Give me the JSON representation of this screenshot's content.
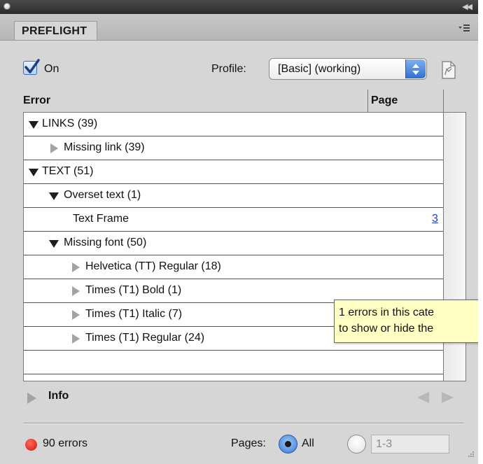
{
  "window": {
    "collapse_icon": "double-chevron-right-icon"
  },
  "panel": {
    "tab_label": "PREFLIGHT",
    "menu_icon": "panel-menu-icon"
  },
  "controls": {
    "on_label": "On",
    "on_checked": true,
    "profile_label": "Profile:",
    "profile_value": "[Basic] (working)"
  },
  "table": {
    "columns": [
      "Error",
      "Page"
    ],
    "rows": [
      {
        "label": "LINKS (39)",
        "level": 0,
        "expander": "expanded",
        "page": ""
      },
      {
        "label": "Missing link (39)",
        "level": 1,
        "expander": "collapsed",
        "page": ""
      },
      {
        "label": "TEXT (51)",
        "level": 0,
        "expander": "expanded",
        "page": ""
      },
      {
        "label": "Overset text (1)",
        "level": 1,
        "expander": "expanded",
        "page": ""
      },
      {
        "label": "Text Frame",
        "level": 2,
        "expander": "none",
        "page": "3"
      },
      {
        "label": "Missing font (50)",
        "level": 1,
        "expander": "expanded",
        "page": ""
      },
      {
        "label": "Helvetica (TT) Regular (18)",
        "level": 2,
        "expander": "collapsed",
        "page": ""
      },
      {
        "label": "Times (T1) Bold (1)",
        "level": 2,
        "expander": "collapsed",
        "page": ""
      },
      {
        "label": "Times (T1) Italic (7)",
        "level": 2,
        "expander": "collapsed",
        "page": ""
      },
      {
        "label": "Times (T1) Regular (24)",
        "level": 2,
        "expander": "collapsed",
        "page": ""
      }
    ]
  },
  "tooltip": {
    "line1": "1 errors in this cate",
    "line2": "to show or hide the"
  },
  "info": {
    "label": "Info"
  },
  "status": {
    "errors_label": "90 errors",
    "status_color": "#e8261a",
    "pages_label": "Pages:",
    "all_label": "All",
    "all_selected": true,
    "range_value": "1-3"
  }
}
